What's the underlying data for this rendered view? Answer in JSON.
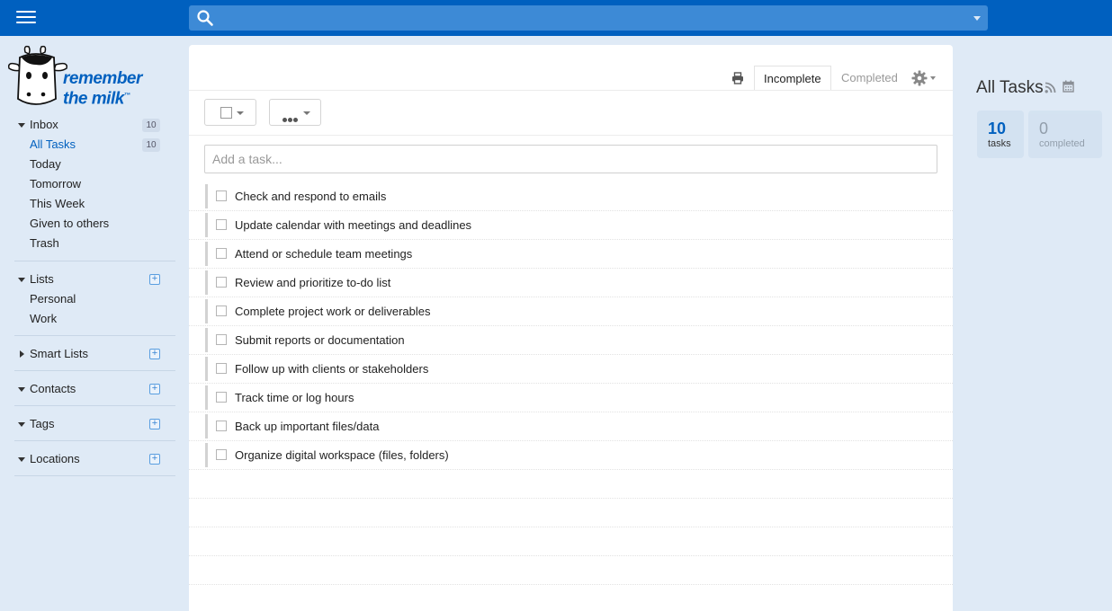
{
  "colors": {
    "topbar": "#0060bf",
    "search_bg": "#3d8ad6",
    "sidebar_bg": "#dfeaf6",
    "accent": "#0060bf"
  },
  "header": {
    "search_placeholder": "",
    "menu_icon": "hamburger-icon",
    "search_icon": "search-icon"
  },
  "logo": {
    "line1": "remember",
    "line2": "the milk",
    "tm": "™"
  },
  "sidebar": {
    "inbox": {
      "label": "Inbox",
      "count": "10"
    },
    "items": [
      {
        "label": "All Tasks",
        "count": "10",
        "active": true
      },
      {
        "label": "Today"
      },
      {
        "label": "Tomorrow"
      },
      {
        "label": "This Week"
      },
      {
        "label": "Given to others"
      },
      {
        "label": "Trash"
      }
    ],
    "lists": {
      "label": "Lists",
      "items": [
        "Personal",
        "Work"
      ]
    },
    "smart_lists": {
      "label": "Smart Lists"
    },
    "contacts": {
      "label": "Contacts"
    },
    "tags": {
      "label": "Tags"
    },
    "locations": {
      "label": "Locations"
    }
  },
  "main": {
    "tabs": {
      "incomplete": "Incomplete",
      "completed": "Completed"
    },
    "add_task_placeholder": "Add a task...",
    "tasks": [
      "Check and respond to emails",
      "Update calendar with meetings and deadlines",
      "Attend or schedule team meetings",
      "Review and prioritize to-do list",
      "Complete project work or deliverables",
      "Submit reports or documentation",
      "Follow up with clients or stakeholders",
      "Track time or log hours",
      "Back up important files/data",
      "Organize digital workspace (files, folders)"
    ]
  },
  "right_panel": {
    "title": "All Tasks",
    "tasks_count": "10",
    "tasks_label": "tasks",
    "completed_count": "0",
    "completed_label": "completed"
  }
}
